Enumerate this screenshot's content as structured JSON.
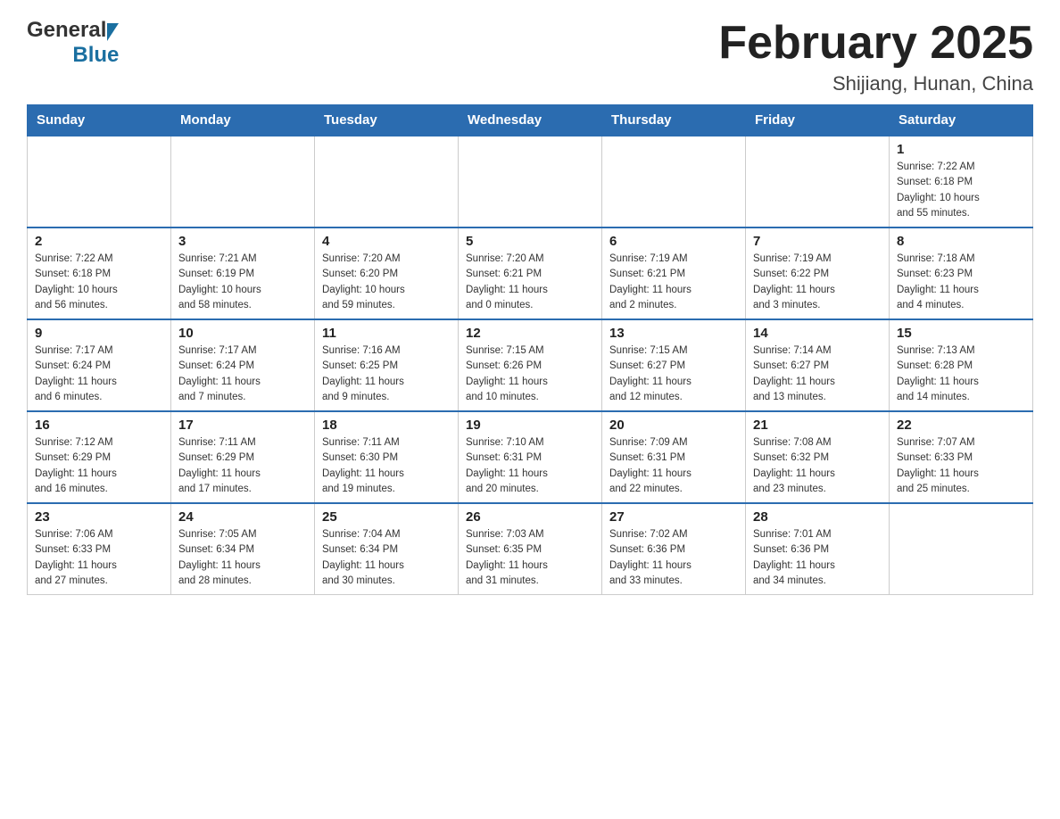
{
  "header": {
    "logo_general": "General",
    "logo_blue": "Blue",
    "title": "February 2025",
    "location": "Shijiang, Hunan, China"
  },
  "days_of_week": [
    "Sunday",
    "Monday",
    "Tuesday",
    "Wednesday",
    "Thursday",
    "Friday",
    "Saturday"
  ],
  "weeks": [
    [
      {
        "day": "",
        "info": ""
      },
      {
        "day": "",
        "info": ""
      },
      {
        "day": "",
        "info": ""
      },
      {
        "day": "",
        "info": ""
      },
      {
        "day": "",
        "info": ""
      },
      {
        "day": "",
        "info": ""
      },
      {
        "day": "1",
        "info": "Sunrise: 7:22 AM\nSunset: 6:18 PM\nDaylight: 10 hours\nand 55 minutes."
      }
    ],
    [
      {
        "day": "2",
        "info": "Sunrise: 7:22 AM\nSunset: 6:18 PM\nDaylight: 10 hours\nand 56 minutes."
      },
      {
        "day": "3",
        "info": "Sunrise: 7:21 AM\nSunset: 6:19 PM\nDaylight: 10 hours\nand 58 minutes."
      },
      {
        "day": "4",
        "info": "Sunrise: 7:20 AM\nSunset: 6:20 PM\nDaylight: 10 hours\nand 59 minutes."
      },
      {
        "day": "5",
        "info": "Sunrise: 7:20 AM\nSunset: 6:21 PM\nDaylight: 11 hours\nand 0 minutes."
      },
      {
        "day": "6",
        "info": "Sunrise: 7:19 AM\nSunset: 6:21 PM\nDaylight: 11 hours\nand 2 minutes."
      },
      {
        "day": "7",
        "info": "Sunrise: 7:19 AM\nSunset: 6:22 PM\nDaylight: 11 hours\nand 3 minutes."
      },
      {
        "day": "8",
        "info": "Sunrise: 7:18 AM\nSunset: 6:23 PM\nDaylight: 11 hours\nand 4 minutes."
      }
    ],
    [
      {
        "day": "9",
        "info": "Sunrise: 7:17 AM\nSunset: 6:24 PM\nDaylight: 11 hours\nand 6 minutes."
      },
      {
        "day": "10",
        "info": "Sunrise: 7:17 AM\nSunset: 6:24 PM\nDaylight: 11 hours\nand 7 minutes."
      },
      {
        "day": "11",
        "info": "Sunrise: 7:16 AM\nSunset: 6:25 PM\nDaylight: 11 hours\nand 9 minutes."
      },
      {
        "day": "12",
        "info": "Sunrise: 7:15 AM\nSunset: 6:26 PM\nDaylight: 11 hours\nand 10 minutes."
      },
      {
        "day": "13",
        "info": "Sunrise: 7:15 AM\nSunset: 6:27 PM\nDaylight: 11 hours\nand 12 minutes."
      },
      {
        "day": "14",
        "info": "Sunrise: 7:14 AM\nSunset: 6:27 PM\nDaylight: 11 hours\nand 13 minutes."
      },
      {
        "day": "15",
        "info": "Sunrise: 7:13 AM\nSunset: 6:28 PM\nDaylight: 11 hours\nand 14 minutes."
      }
    ],
    [
      {
        "day": "16",
        "info": "Sunrise: 7:12 AM\nSunset: 6:29 PM\nDaylight: 11 hours\nand 16 minutes."
      },
      {
        "day": "17",
        "info": "Sunrise: 7:11 AM\nSunset: 6:29 PM\nDaylight: 11 hours\nand 17 minutes."
      },
      {
        "day": "18",
        "info": "Sunrise: 7:11 AM\nSunset: 6:30 PM\nDaylight: 11 hours\nand 19 minutes."
      },
      {
        "day": "19",
        "info": "Sunrise: 7:10 AM\nSunset: 6:31 PM\nDaylight: 11 hours\nand 20 minutes."
      },
      {
        "day": "20",
        "info": "Sunrise: 7:09 AM\nSunset: 6:31 PM\nDaylight: 11 hours\nand 22 minutes."
      },
      {
        "day": "21",
        "info": "Sunrise: 7:08 AM\nSunset: 6:32 PM\nDaylight: 11 hours\nand 23 minutes."
      },
      {
        "day": "22",
        "info": "Sunrise: 7:07 AM\nSunset: 6:33 PM\nDaylight: 11 hours\nand 25 minutes."
      }
    ],
    [
      {
        "day": "23",
        "info": "Sunrise: 7:06 AM\nSunset: 6:33 PM\nDaylight: 11 hours\nand 27 minutes."
      },
      {
        "day": "24",
        "info": "Sunrise: 7:05 AM\nSunset: 6:34 PM\nDaylight: 11 hours\nand 28 minutes."
      },
      {
        "day": "25",
        "info": "Sunrise: 7:04 AM\nSunset: 6:34 PM\nDaylight: 11 hours\nand 30 minutes."
      },
      {
        "day": "26",
        "info": "Sunrise: 7:03 AM\nSunset: 6:35 PM\nDaylight: 11 hours\nand 31 minutes."
      },
      {
        "day": "27",
        "info": "Sunrise: 7:02 AM\nSunset: 6:36 PM\nDaylight: 11 hours\nand 33 minutes."
      },
      {
        "day": "28",
        "info": "Sunrise: 7:01 AM\nSunset: 6:36 PM\nDaylight: 11 hours\nand 34 minutes."
      },
      {
        "day": "",
        "info": ""
      }
    ]
  ]
}
